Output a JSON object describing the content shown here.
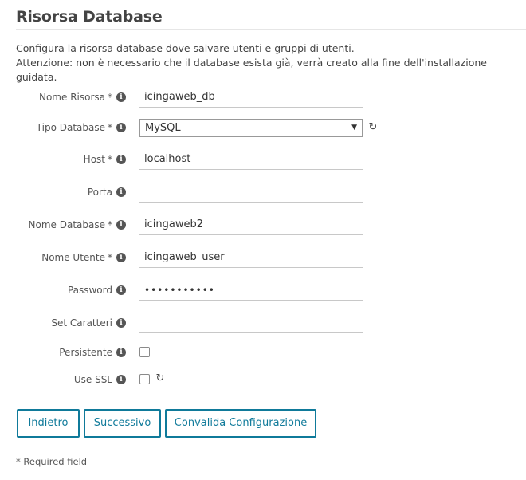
{
  "header": {
    "title": "Risorsa Database",
    "intro_line1": "Configura la risorsa database dove salvare utenti e gruppi di utenti.",
    "intro_line2": "Attenzione: non è necessario che il database esista già, verrà creato alla fine dell'installazione guidata."
  },
  "form": {
    "resource_name": {
      "label": "Nome Risorsa",
      "required": "*",
      "value": "icingaweb_db"
    },
    "db_type": {
      "label": "Tipo Database",
      "required": "*",
      "selected": "MySQL"
    },
    "host": {
      "label": "Host",
      "required": "*",
      "value": "localhost"
    },
    "port": {
      "label": "Porta",
      "value": ""
    },
    "db_name": {
      "label": "Nome Database",
      "required": "*",
      "value": "icingaweb2"
    },
    "username": {
      "label": "Nome Utente",
      "required": "*",
      "value": "icingaweb_user"
    },
    "password": {
      "label": "Password",
      "value": "•••••••••••"
    },
    "charset": {
      "label": "Set Caratteri",
      "value": ""
    },
    "persistent": {
      "label": "Persistente",
      "checked": false
    },
    "use_ssl": {
      "label": "Use SSL",
      "checked": false
    }
  },
  "buttons": {
    "back": "Indietro",
    "next": "Successivo",
    "validate": "Convalida Configurazione"
  },
  "footer": {
    "required_note": "* Required field"
  },
  "icons": {
    "info": "info-icon",
    "reload": "reload-icon"
  },
  "colors": {
    "accent": "#0f7a9a"
  }
}
